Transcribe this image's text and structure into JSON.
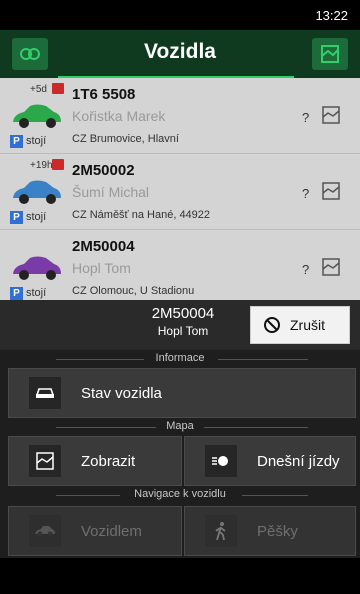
{
  "status": {
    "time": "13:22"
  },
  "header": {
    "title": "Vozidla"
  },
  "vehicles": [
    {
      "age": "+5d",
      "plate": "1T6 5508",
      "driver": "Kořistka Marek",
      "state": "stojí",
      "address": "CZ Brumovice, Hlavní",
      "mark": "?",
      "color": "#2aa84a"
    },
    {
      "age": "+19h",
      "plate": "2M50002",
      "driver": "Šumí Michal",
      "state": "stojí",
      "address": "CZ Náměšť na Hané, 44922",
      "mark": "?",
      "color": "#3a82c8"
    },
    {
      "age": "",
      "plate": "2M50004",
      "driver": "Hopl Tom",
      "state": "stojí",
      "address": "CZ Olomouc, U Stadionu",
      "mark": "?",
      "color": "#7a3aa8"
    }
  ],
  "selected": {
    "plate": "2M50004",
    "driver": "Hopl Tom",
    "cancel_label": "Zrušit"
  },
  "sections": {
    "info": "Informace",
    "map": "Mapa",
    "nav": "Navigace k vozidlu"
  },
  "actions": {
    "vehicle_state": "Stav vozidla",
    "show": "Zobrazit",
    "today_rides": "Dnešní jízdy",
    "by_vehicle": "Vozidlem",
    "on_foot": "Pěšky"
  }
}
